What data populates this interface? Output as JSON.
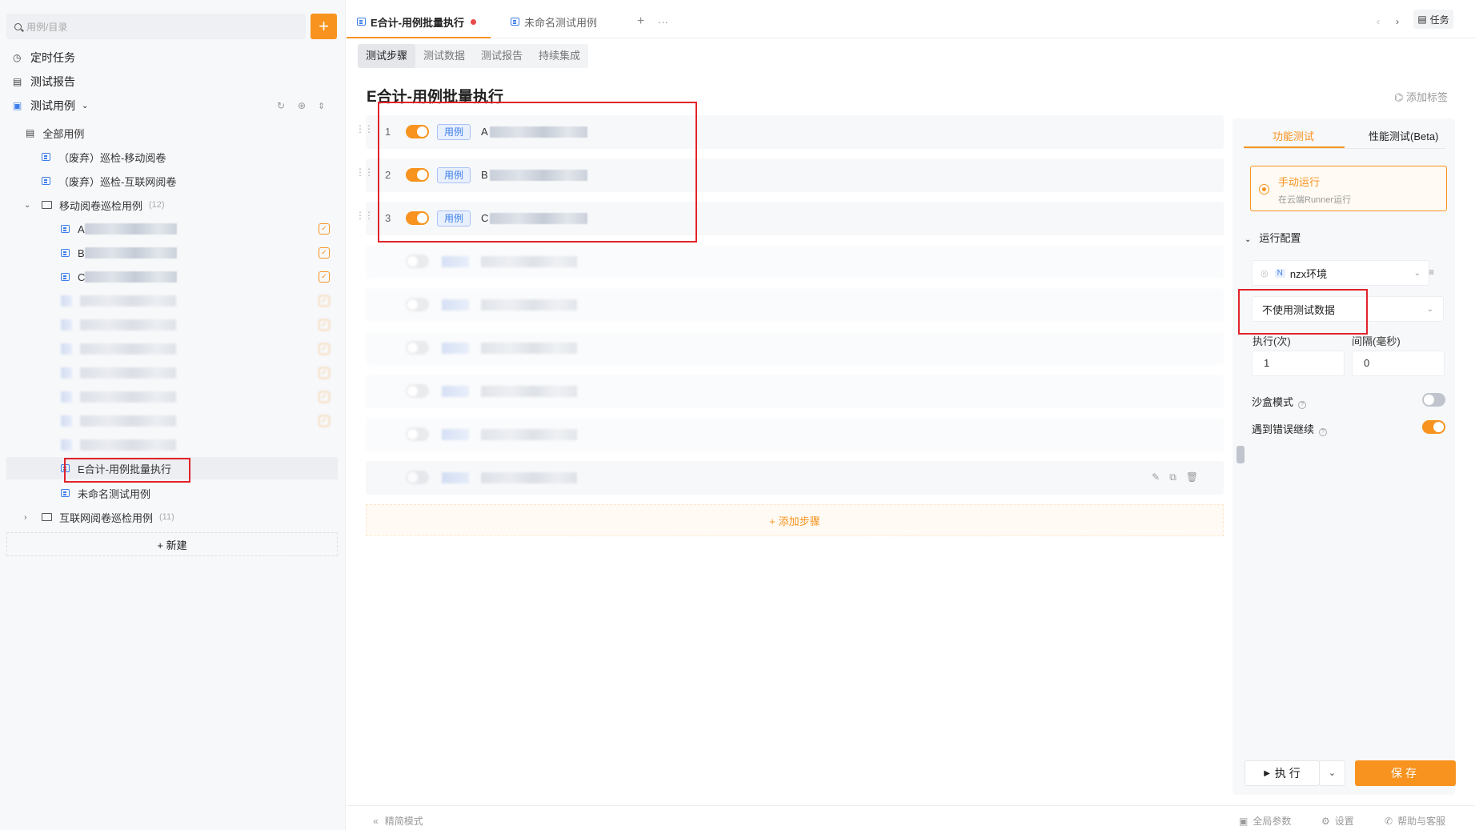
{
  "sidebar": {
    "search_placeholder": "用例/目录",
    "add_label": "+",
    "nav": {
      "scheduled": "定时任务",
      "reports": "测试报告",
      "cases": "测试用例"
    },
    "tree": {
      "all": "全部用例",
      "deprecated_mobile": "（废弃）巡检-移动阅卷",
      "deprecated_web": "（废弃）巡检-互联网阅卷",
      "mobile_folder": "移动阅卷巡检用例",
      "mobile_count": "(12)",
      "item_a": "A",
      "item_b": "B",
      "item_c": "C",
      "selected": "E合计-用例批量执行",
      "unnamed": "未命名测试用例",
      "web_folder": "互联网阅卷巡检用例",
      "web_count": "(11)"
    },
    "new_label": "+ 新建"
  },
  "tabs": {
    "active": "E合计-用例批量执行",
    "second": "未命名测试用例",
    "plus": "+",
    "more": "···",
    "task": "任务"
  },
  "subtabs": [
    "测试步骤",
    "测试数据",
    "测试报告",
    "持续集成"
  ],
  "page_title": "E合计-用例批量执行",
  "add_tag": "添加标签",
  "steps": [
    {
      "num": "1",
      "tag": "用例",
      "name": "A"
    },
    {
      "num": "2",
      "tag": "用例",
      "name": "B"
    },
    {
      "num": "3",
      "tag": "用例",
      "name": "C"
    }
  ],
  "add_step": "+ 添加步骤",
  "right": {
    "tab_functional": "功能测试",
    "tab_perf": "性能测试(Beta)",
    "manual_title": "手动运行",
    "manual_sub": "在云端Runner运行",
    "config_title": "运行配置",
    "env_badge": "N",
    "env_name": "nzx环境",
    "data_select": "不使用测试数据",
    "exec_label": "执行(次)",
    "interval_label": "间隔(毫秒)",
    "exec_value": "1",
    "interval_value": "0",
    "sandbox_label": "沙盒模式",
    "continue_label": "遇到错误继续",
    "sandbox_on": false,
    "continue_on": true,
    "run_label": "执 行",
    "save_label": "保存"
  },
  "bottom": {
    "simple_mode": "精简模式",
    "global_params": "全局参数",
    "settings": "设置",
    "help": "帮助与客服"
  }
}
